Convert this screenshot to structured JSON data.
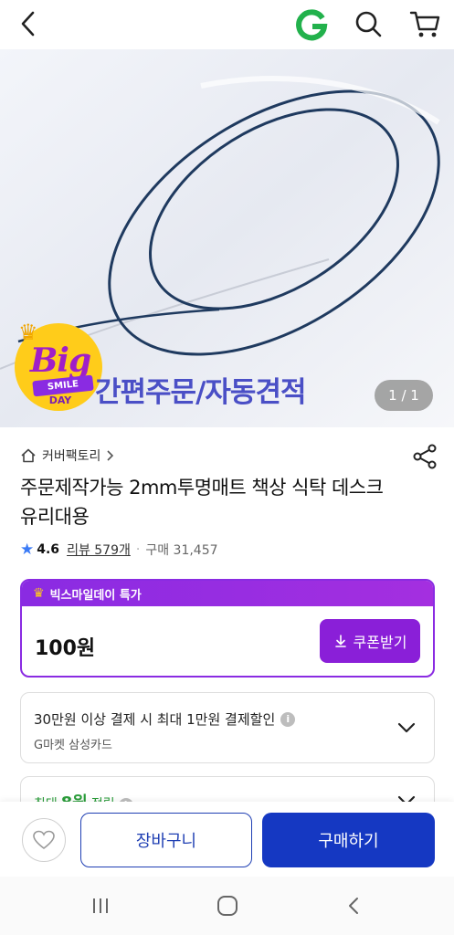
{
  "header": {
    "back_icon": "chevron-left-icon",
    "logo_letter": "G",
    "logo_color": "#22b14c",
    "search_icon": "search-icon",
    "cart_icon": "cart-icon"
  },
  "hero": {
    "caption": "간편주문/자동견적",
    "counter": "1 / 1",
    "badge": {
      "big": "Big",
      "smile": "SMILE",
      "day": "DAY"
    }
  },
  "product": {
    "seller": "커버팩토리",
    "title": "주문제작가능 2mm투명매트 책상 식탁 데스크 유리대용",
    "rating": "4.6",
    "review": "리뷰 579개",
    "separator": "·",
    "purchase": "구매 31,457"
  },
  "deal": {
    "label": "빅스마일데이 특가",
    "price": "100원",
    "coupon_button": "쿠폰받기",
    "accent_color": "#8a2be2"
  },
  "card_benefit": {
    "main": "30만원 이상 결제 시 최대 1만원 결제할인",
    "sub": "G마켓 삼성카드"
  },
  "points": {
    "prefix": "최대",
    "value": "8원",
    "suffix": "적립"
  },
  "actions": {
    "wish_icon": "heart-icon",
    "cart_label": "장바구니",
    "buy_label": "구매하기",
    "buy_color": "#1538c2"
  },
  "system_nav": {
    "recent_icon": "recent-apps-icon",
    "home_icon": "home-icon",
    "back_icon": "back-icon"
  }
}
